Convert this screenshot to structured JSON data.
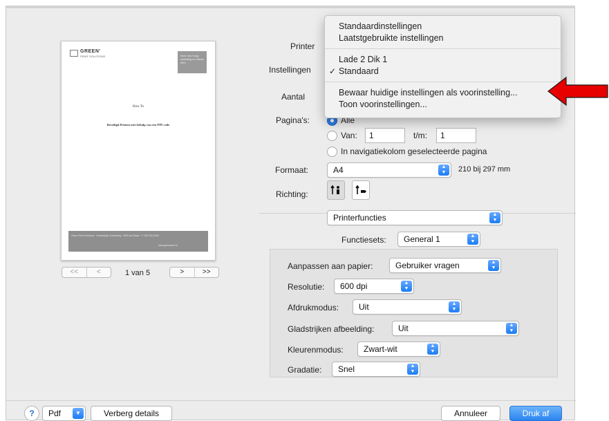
{
  "preview": {
    "logo_text": "GREEN'",
    "logo_sub": "PRINT SOLUTIONS",
    "header_box_text": "Door ons hoog opleiding en klasse bied",
    "doc_title": "How To",
    "doc_subtitle": "Beveiligd Printen met behulp van een PIN code",
    "footer_left": "Green Print Solutions · Kamerlingh Onnesweg · 0000 AA Plaats · T: 000 000 0000",
    "footer_right": "www.greenprint.nl"
  },
  "nav": {
    "first": "<<",
    "prev": "<",
    "next": ">",
    "last": ">>",
    "page_count": "1 van 5"
  },
  "form": {
    "printer_label": "Printer",
    "settings_label": "Instellingen",
    "copies_label": "Aantal",
    "pages_label": "Pagina's:",
    "pages_all": "Alle",
    "pages_from": "Van:",
    "pages_from_value": "1",
    "pages_to": "t/m:",
    "pages_to_value": "1",
    "pages_nav_selected": "In navigatiekolom geselecteerde pagina",
    "format_label": "Formaat:",
    "format_value": "A4",
    "format_size": "210 bij 297 mm",
    "orientation_label": "Richting:",
    "section_value": "Printerfuncties",
    "featuresets_label": "Functiesets:",
    "featuresets_value": "General 1"
  },
  "features": {
    "fit_label": "Aanpassen aan papier:",
    "fit_value": "Gebruiker vragen",
    "resolution_label": "Resolutie:",
    "resolution_value": "600 dpi",
    "printmode_label": "Afdrukmodus:",
    "printmode_value": "Uit",
    "smoothing_label": "Gladstrijken afbeelding:",
    "smoothing_value": "Uit",
    "colormode_label": "Kleurenmodus:",
    "colormode_value": "Zwart-wit",
    "gradation_label": "Gradatie:",
    "gradation_value": "Snel"
  },
  "footer": {
    "help": "?",
    "pdf": "Pdf",
    "hide_details": "Verberg details",
    "cancel": "Annuleer",
    "print": "Druk af"
  },
  "menu": {
    "item_default": "Standaardinstellingen",
    "item_last_used": "Laatstgebruikte instellingen",
    "item_tray": "Lade 2 Dik 1",
    "check": "✓",
    "item_standard": "Standaard",
    "item_save": "Bewaar huidige instellingen als voorinstelling...",
    "item_show": "Toon voorinstellingen..."
  },
  "colors": {
    "accent": "#2a84f0",
    "arrow": "#e60000"
  },
  "icons": {
    "portrait": "portrait-orientation-icon",
    "landscape": "landscape-orientation-icon",
    "stepper": "chevron-updown-icon",
    "arrow": "red-arrow-icon"
  }
}
